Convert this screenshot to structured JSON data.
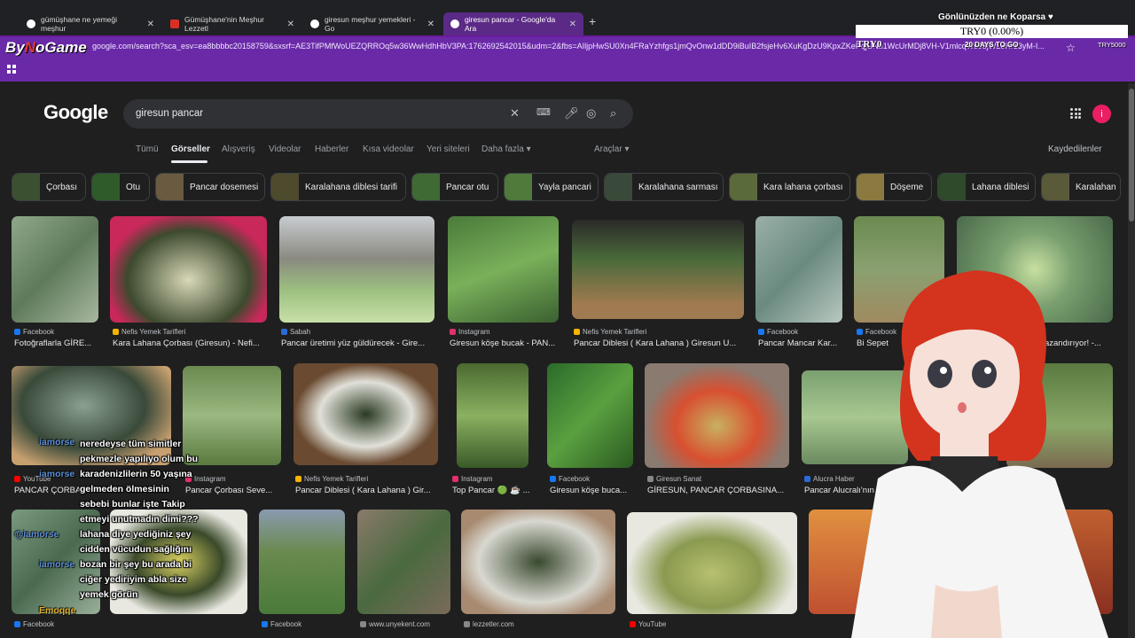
{
  "browser": {
    "tabs": [
      {
        "title": "gümüşhane ne yemeği meşhur",
        "close": "✕"
      },
      {
        "title": "Gümüşhane'nin Meşhur Lezzetl",
        "close": "✕"
      },
      {
        "title": "giresun meşhur yemekleri - Go",
        "close": "✕"
      },
      {
        "title": "giresun pancar - Google'da Ara",
        "close": "✕"
      }
    ],
    "new_tab": "+",
    "url": "google.com/search?sca_esv=ea8bbbbc20158759&sxsrf=AE3TifPMfWoUEZQRROq5w36WwHdhHbV3PA:1762692542015&udm=2&fbs=AIljpHwSU0Xn4FRaYzhfgs1jmQvOnw1dDD9iBuIB2fsjeHv6XuKgDzU9KpxZKePqjUNb1WcUrMDj8VH-V1mlcqWs95jW16Hr13yM-I..."
  },
  "stream_logo": {
    "prefix": "By",
    "n": "N",
    "suffix": "oGame"
  },
  "google": {
    "logo": "Google",
    "query": "giresun pancar",
    "nav": [
      "Tümü",
      "Görseller",
      "Alışveriş",
      "Videolar",
      "Haberler",
      "Kısa videolar",
      "Yeri siteleri",
      "Daha fazla ▾"
    ],
    "tools": "Araçlar ▾",
    "saved": "Kaydedilenler",
    "avatar_letter": "i"
  },
  "chips": [
    "Çorbası",
    "Otu",
    "Pancar dosemesi",
    "Karalahana diblesi tarifi",
    "Pancar otu",
    "Yayla pancari",
    "Karalahana sarması",
    "Kara lahana çorbası",
    "Döşeme",
    "Lahana diblesi",
    "Karalahan"
  ],
  "results": [
    {
      "source": "Facebook",
      "caption": "Fotoğraflarla GİRE..."
    },
    {
      "source": "Nefis Yemek Tarifleri",
      "caption": "Kara Lahana Çorbası (Giresun) - Nefi..."
    },
    {
      "source": "Sabah",
      "caption": "Pancar üretimi yüz güldürecek - Gire..."
    },
    {
      "source": "Instagram",
      "caption": "Giresun köşe bucak - PAN..."
    },
    {
      "source": "Nefis Yemek Tarifleri",
      "caption": "Pancar Diblesi ( Kara Lahana ) Giresun U..."
    },
    {
      "source": "Facebook",
      "caption": "Pancar Mancar Kar..."
    },
    {
      "source": "Facebook",
      "caption": "Bi Sepet"
    },
    {
      "source": "gazetesi",
      "caption": "...ine kazandırıyor! -..."
    },
    {
      "source": "YouTube",
      "caption": "PANCAR ÇORBA..."
    },
    {
      "source": "Instagram",
      "caption": "Pancar Çorbası Seve..."
    },
    {
      "source": "Nefis Yemek Tarifleri",
      "caption": "Pancar Diblesi ( Kara Lahana ) Gir..."
    },
    {
      "source": "Instagram",
      "caption": "Top Pancar 🟢 ☕ ..."
    },
    {
      "source": "Facebook",
      "caption": "Giresun köşe buca..."
    },
    {
      "source": "Giresun Sanat",
      "caption": "GİRESUN, PANCAR ÇORBASINA..."
    },
    {
      "source": "Alucra Haber",
      "caption": "Pancar Alucralı'nın"
    },
    {
      "source": "Facebook",
      "caption": ""
    },
    {
      "source": "Facebook",
      "caption": ""
    },
    {
      "source": "www.unyekent.com",
      "caption": ""
    },
    {
      "source": "lezzetler.com",
      "caption": ""
    },
    {
      "source": "YouTube",
      "caption": ""
    }
  ],
  "stream_overlay": {
    "goal_title": "Gönlünüzden ne Koparsa ♥",
    "goal_bar": "TRY0 (0.00%)",
    "goal_current": "TRY0",
    "days_left": "20 DAYS TO GO",
    "goal_target": "TRY5000"
  },
  "chat": {
    "names": [
      "iamorse",
      "iamorse",
      "@iamorse",
      "iamorse",
      "Emoqqe"
    ],
    "messages": [
      "neredeyse tüm simitler pekmezle yapılıyo olum bu karadenizlilerin 50 yaşına gelmeden ölmesinin sebebi bunlar işte Takip etmeyi unutmadın dimi??? lahana diye yediğiniz şey cidden vücudun sağlığını bozan bir şey bu arada bi ciğer yediriyim abla size yemek görün"
    ]
  },
  "colors": {
    "accent_purple": "#6a2aa8",
    "tab_active": "#5b2a86",
    "google_bg": "#1f1f1f",
    "avatar": "#e91e63"
  }
}
